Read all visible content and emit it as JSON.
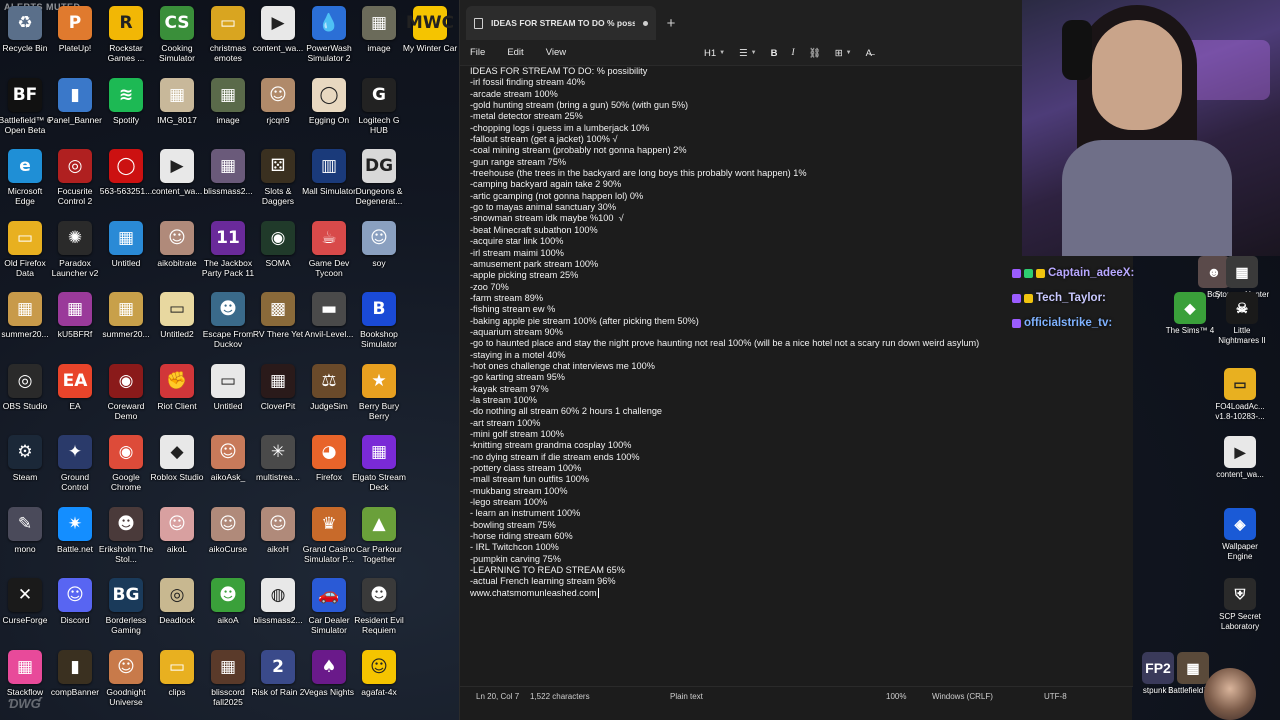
{
  "overlay": {
    "alerts_muted": "ALERTS MUTED"
  },
  "desktop_icons": [
    {
      "label": "Recycle Bin",
      "color": "#5a6f8a",
      "glyph": "♻",
      "col": 0,
      "row": 0
    },
    {
      "label": "PlateUp!",
      "color": "#e07a2e",
      "glyph": "P",
      "col": 1,
      "row": 0
    },
    {
      "label": "Rockstar Games ...",
      "color": "#f2b705",
      "glyph": "R",
      "col": 2,
      "row": 0
    },
    {
      "label": "Cooking Simulator",
      "color": "#3a8f3a",
      "glyph": "CS",
      "col": 3,
      "row": 0
    },
    {
      "label": "christmas emotes",
      "color": "#d9a520",
      "glyph": "▭",
      "col": 4,
      "row": 0
    },
    {
      "label": "content_wa...",
      "color": "#e8e8e8",
      "glyph": "▶",
      "col": 5,
      "row": 0
    },
    {
      "label": "PowerWash Simulator 2",
      "color": "#2b6fd6",
      "glyph": "💧",
      "col": 6,
      "row": 0
    },
    {
      "label": "image",
      "color": "#6b6b5a",
      "glyph": "▦",
      "col": 7,
      "row": 0
    },
    {
      "label": "My Winter Car",
      "color": "#f5c400",
      "glyph": "MWC",
      "col": 8,
      "row": 0
    },
    {
      "label": "Battlefield™ 6 Open Beta",
      "color": "#111111",
      "glyph": "BF",
      "col": 0,
      "row": 1
    },
    {
      "label": "Panel_Banner",
      "color": "#3a78c9",
      "glyph": "▮",
      "col": 1,
      "row": 1
    },
    {
      "label": "Spotify",
      "color": "#1db954",
      "glyph": "≋",
      "col": 2,
      "row": 1
    },
    {
      "label": "IMG_8017",
      "color": "#c8b89a",
      "glyph": "▦",
      "col": 3,
      "row": 1
    },
    {
      "label": "image",
      "color": "#5a6a4a",
      "glyph": "▦",
      "col": 4,
      "row": 1
    },
    {
      "label": "rjcqn9",
      "color": "#b08a6a",
      "glyph": "☺",
      "col": 5,
      "row": 1
    },
    {
      "label": "Egging On",
      "color": "#e8d8c0",
      "glyph": "◯",
      "col": 6,
      "row": 1
    },
    {
      "label": "Logitech G HUB",
      "color": "#222222",
      "glyph": "G",
      "col": 7,
      "row": 1
    },
    {
      "label": "Microsoft Edge",
      "color": "#1f8fd6",
      "glyph": "e",
      "col": 0,
      "row": 2
    },
    {
      "label": "Focusrite Control 2",
      "color": "#b02020",
      "glyph": "◎",
      "col": 1,
      "row": 2
    },
    {
      "label": "563-563251...",
      "color": "#cc1111",
      "glyph": "◯",
      "col": 2,
      "row": 2
    },
    {
      "label": "content_wa...",
      "color": "#e8e8e8",
      "glyph": "▶",
      "col": 3,
      "row": 2
    },
    {
      "label": "blissmass2...",
      "color": "#6a5a7a",
      "glyph": "▦",
      "col": 4,
      "row": 2
    },
    {
      "label": "Slots & Daggers",
      "color": "#3a3020",
      "glyph": "⚄",
      "col": 5,
      "row": 2
    },
    {
      "label": "Mall Simulator",
      "color": "#1a3a7a",
      "glyph": "▥",
      "col": 6,
      "row": 2
    },
    {
      "label": "Dungeons & Degenerat...",
      "color": "#d8d8d8",
      "glyph": "DG",
      "col": 7,
      "row": 2
    },
    {
      "label": "Old Firefox Data",
      "color": "#e8b020",
      "glyph": "▭",
      "col": 0,
      "row": 3
    },
    {
      "label": "Paradox Launcher v2",
      "color": "#2a2a2a",
      "glyph": "✺",
      "col": 1,
      "row": 3
    },
    {
      "label": "Untitled",
      "color": "#2a8ad6",
      "glyph": "▦",
      "col": 2,
      "row": 3
    },
    {
      "label": "aikobitrate",
      "color": "#b08a7a",
      "glyph": "☺",
      "col": 3,
      "row": 3
    },
    {
      "label": "The Jackbox Party Pack 11",
      "color": "#6a2a9a",
      "glyph": "11",
      "col": 4,
      "row": 3
    },
    {
      "label": "SOMA",
      "color": "#203a2a",
      "glyph": "◉",
      "col": 5,
      "row": 3
    },
    {
      "label": "Game Dev Tycoon",
      "color": "#d84a4a",
      "glyph": "☕",
      "col": 6,
      "row": 3
    },
    {
      "label": "soy",
      "color": "#8aa0c0",
      "glyph": "☺",
      "col": 7,
      "row": 3
    },
    {
      "label": "summer20...",
      "color": "#c89a4a",
      "glyph": "▦",
      "col": 0,
      "row": 4
    },
    {
      "label": "kU5BFRf",
      "color": "#9a3a9a",
      "glyph": "▦",
      "col": 1,
      "row": 4
    },
    {
      "label": "summer20...",
      "color": "#c8a04a",
      "glyph": "▦",
      "col": 2,
      "row": 4
    },
    {
      "label": "Untitled2",
      "color": "#e8d8a0",
      "glyph": "▭",
      "col": 3,
      "row": 4
    },
    {
      "label": "Escape From Duckov",
      "color": "#3a6a8a",
      "glyph": "☻",
      "col": 4,
      "row": 4
    },
    {
      "label": "RV There Yet",
      "color": "#8a6a3a",
      "glyph": "▩",
      "col": 5,
      "row": 4
    },
    {
      "label": "Anvil-Level...",
      "color": "#4a4a4a",
      "glyph": "▬",
      "col": 6,
      "row": 4
    },
    {
      "label": "Bookshop Simulator",
      "color": "#1a4ad6",
      "glyph": "B",
      "col": 7,
      "row": 4
    },
    {
      "label": "OBS Studio",
      "color": "#2a2a2a",
      "glyph": "◎",
      "col": 0,
      "row": 5
    },
    {
      "label": "EA",
      "color": "#e8442a",
      "glyph": "EA",
      "col": 1,
      "row": 5
    },
    {
      "label": "Coreward Demo",
      "color": "#8a1a1a",
      "glyph": "◉",
      "col": 2,
      "row": 5
    },
    {
      "label": "Riot Client",
      "color": "#d13639",
      "glyph": "✊",
      "col": 3,
      "row": 5
    },
    {
      "label": "Untitled",
      "color": "#e8e8e8",
      "glyph": "▭",
      "col": 4,
      "row": 5
    },
    {
      "label": "CloverPit",
      "color": "#2a1a1a",
      "glyph": "▦",
      "col": 5,
      "row": 5
    },
    {
      "label": "JudgeSim",
      "color": "#6a4a2a",
      "glyph": "⚖",
      "col": 6,
      "row": 5
    },
    {
      "label": "Berry Bury Berry",
      "color": "#e8a020",
      "glyph": "★",
      "col": 7,
      "row": 5
    },
    {
      "label": "Steam",
      "color": "#1b2838",
      "glyph": "⚙",
      "col": 0,
      "row": 6
    },
    {
      "label": "Ground Control",
      "color": "#2a3a6a",
      "glyph": "✦",
      "col": 1,
      "row": 6
    },
    {
      "label": "Google Chrome",
      "color": "#dd4b39",
      "glyph": "◉",
      "col": 2,
      "row": 6
    },
    {
      "label": "Roblox Studio",
      "color": "#e8e8e8",
      "glyph": "◆",
      "col": 3,
      "row": 6
    },
    {
      "label": "aikoAsk_",
      "color": "#c87a5a",
      "glyph": "☺",
      "col": 4,
      "row": 6
    },
    {
      "label": "multistrea...",
      "color": "#4a4a4a",
      "glyph": "✳",
      "col": 5,
      "row": 6
    },
    {
      "label": "Firefox",
      "color": "#e8642a",
      "glyph": "◕",
      "col": 6,
      "row": 6
    },
    {
      "label": "Elgato Stream Deck",
      "color": "#7a2ad6",
      "glyph": "▦",
      "col": 7,
      "row": 6
    },
    {
      "label": "mono",
      "color": "#4a4a5a",
      "glyph": "✎",
      "col": 0,
      "row": 7
    },
    {
      "label": "Battle.net",
      "color": "#148eff",
      "glyph": "✷",
      "col": 1,
      "row": 7
    },
    {
      "label": "Eriksholm The Stol...",
      "color": "#4a3a3a",
      "glyph": "☻",
      "col": 2,
      "row": 7
    },
    {
      "label": "aikoL",
      "color": "#d8a0a0",
      "glyph": "☺",
      "col": 3,
      "row": 7
    },
    {
      "label": "aikoCurse",
      "color": "#b08a7a",
      "glyph": "☺",
      "col": 4,
      "row": 7
    },
    {
      "label": "aikoH",
      "color": "#b08a7a",
      "glyph": "☺",
      "col": 5,
      "row": 7
    },
    {
      "label": "Grand Casino Simulator P...",
      "color": "#c86a2a",
      "glyph": "♛",
      "col": 6,
      "row": 7
    },
    {
      "label": "Car Parkour Together",
      "color": "#6aa03a",
      "glyph": "▲",
      "col": 7,
      "row": 7
    },
    {
      "label": "CurseForge",
      "color": "#1a1a1a",
      "glyph": "✕",
      "col": 0,
      "row": 8
    },
    {
      "label": "Discord",
      "color": "#5865f2",
      "glyph": "☺",
      "col": 1,
      "row": 8
    },
    {
      "label": "Borderless Gaming",
      "color": "#1a3a5a",
      "glyph": "BG",
      "col": 2,
      "row": 8
    },
    {
      "label": "Deadlock",
      "color": "#c8b890",
      "glyph": "◎",
      "col": 3,
      "row": 8
    },
    {
      "label": "aikoA",
      "color": "#3aa03a",
      "glyph": "☻",
      "col": 4,
      "row": 8
    },
    {
      "label": "blissmass2...",
      "color": "#e8e8e8",
      "glyph": "◍",
      "col": 5,
      "row": 8
    },
    {
      "label": "Car Dealer Simulator",
      "color": "#2a5ad6",
      "glyph": "🚗",
      "col": 6,
      "row": 8
    },
    {
      "label": "Resident Evil Requiem",
      "color": "#3a3a3a",
      "glyph": "☻",
      "col": 7,
      "row": 8
    },
    {
      "label": "Stackflow",
      "color": "#e84a9a",
      "glyph": "▦",
      "col": 0,
      "row": 9
    },
    {
      "label": "compBanner",
      "color": "#3a3020",
      "glyph": "▮",
      "col": 1,
      "row": 9
    },
    {
      "label": "Goodnight Universe",
      "color": "#c87a4a",
      "glyph": "☺",
      "col": 2,
      "row": 9
    },
    {
      "label": "clips",
      "color": "#e8b020",
      "glyph": "▭",
      "col": 3,
      "row": 9
    },
    {
      "label": "blisscord fall2025",
      "color": "#5a3a2a",
      "glyph": "▦",
      "col": 4,
      "row": 9
    },
    {
      "label": "Risk of Rain 2",
      "color": "#3a4a8a",
      "glyph": "2",
      "col": 5,
      "row": 9
    },
    {
      "label": "Vegas Nights",
      "color": "#6a1a8a",
      "glyph": "♠",
      "col": 6,
      "row": 9
    },
    {
      "label": "agafat-4x",
      "color": "#f5c400",
      "glyph": "☺",
      "col": 7,
      "row": 9
    }
  ],
  "notepad": {
    "tab_title": "IDEAS FOR STREAM TO DO % possi",
    "new_tab": "+",
    "menu": [
      "File",
      "Edit",
      "View"
    ],
    "toolbar": {
      "heading": "H1",
      "bold": "B",
      "italic": "I",
      "list": "☰",
      "link": "⛓",
      "table": "⊞",
      "clear": "A̶"
    },
    "lines": [
      "IDEAS FOR STREAM TO DO: % possibility",
      "-irl fossil finding stream 40%",
      "-arcade stream 100%",
      "-gold hunting stream (bring a gun) 50% (with gun 5%)",
      "-metal detector stream 25%",
      "-chopping logs i guess im a lumberjack 10%",
      "-fallout stream (get a jacket) 100% √",
      "-coal mining stream (probably not gonna happen) 2%",
      "-gun range stream 75%",
      "-treehouse (the trees in the backyard are long boys this probably wont happen) 1%",
      "-camping backyard again take 2 90%",
      "-artic gcamping (not gonna happen lol) 0%",
      "-go to mayas animal sanctuary 30%",
      "-snowman stream idk maybe %100  √",
      "-beat Minecraft subathon 100%",
      "-acquire star link 100%",
      "-irl stream maimi 100%",
      "-amusement park stream 100%",
      "-apple picking stream 25%",
      "-zoo 70%",
      "-farm stream 89%",
      "-fishing stream ew %",
      "-baking apple pie stream 100% (after picking them 50%)",
      "-aquarium stream 90%",
      "-go to haunted place and stay the night prove haunting not real 100% (will be a nice hotel not a scary run down weird asylum)",
      "-staying in a motel 40%",
      "-hot ones challenge chat interviews me 100%",
      "-go karting stream 95%",
      "-kayak stream 97%",
      "-la stream 100%",
      "-do nothing all stream 60% 2 hours 1 challenge",
      "-art stream 100%",
      "-mini golf stream 100%",
      "-knitting stream grandma cosplay 100%",
      "-no dying stream if die stream ends 100%",
      "-pottery class stream 100%",
      "-mall stream fun outfits 100%",
      "-mukbang stream 100%",
      "-lego stream 100%",
      "- learn an instrument 100%",
      "-bowling stream 75%",
      "-horse riding stream 60%",
      "- IRL Twitchcon 100%",
      "-pumpkin carving 75%",
      "-LEARNING TO READ STREAM 65%",
      "-actual French learning stream 96%",
      "www.chatsmomunleashed.com"
    ],
    "status": {
      "position": "Ln 20, Col 7",
      "characters": "1,522 characters",
      "format": "Plain text",
      "zoom": "100%",
      "line_ending": "Windows (CRLF)",
      "encoding": "UTF-8"
    }
  },
  "chat": [
    {
      "user": "Captain_adeeX:"
    },
    {
      "user": "Tech_Taylor:"
    },
    {
      "user": "officialstrike_tv:"
    }
  ],
  "right_icons": [
    {
      "label": "Boy",
      "color": "#5a4a4a",
      "glyph": "☻"
    },
    {
      "label": "Storage Hunter",
      "color": "#3a3a3a",
      "glyph": "▦"
    },
    {
      "label": "The Sims™ 4",
      "color": "#3aa03a",
      "glyph": "◆"
    },
    {
      "label": "Little Nightmares II",
      "color": "#1a1a1a",
      "glyph": "☠"
    },
    {
      "label": "FO4LoadAc... v1.8-10283-...",
      "color": "#e8b020",
      "glyph": "▭"
    },
    {
      "label": "content_wa...",
      "color": "#e8e8e8",
      "glyph": "▶"
    },
    {
      "label": "Wallpaper Engine",
      "color": "#1a5ad6",
      "glyph": "◈"
    },
    {
      "label": "SCP Secret Laboratory",
      "color": "#2a2a2a",
      "glyph": "⛨"
    },
    {
      "label": "stpunk 2",
      "color": "#3a3a5a",
      "glyph": "FP2"
    },
    {
      "label": "Battlefield™...",
      "color": "#5a4a3a",
      "glyph": "▦"
    }
  ]
}
